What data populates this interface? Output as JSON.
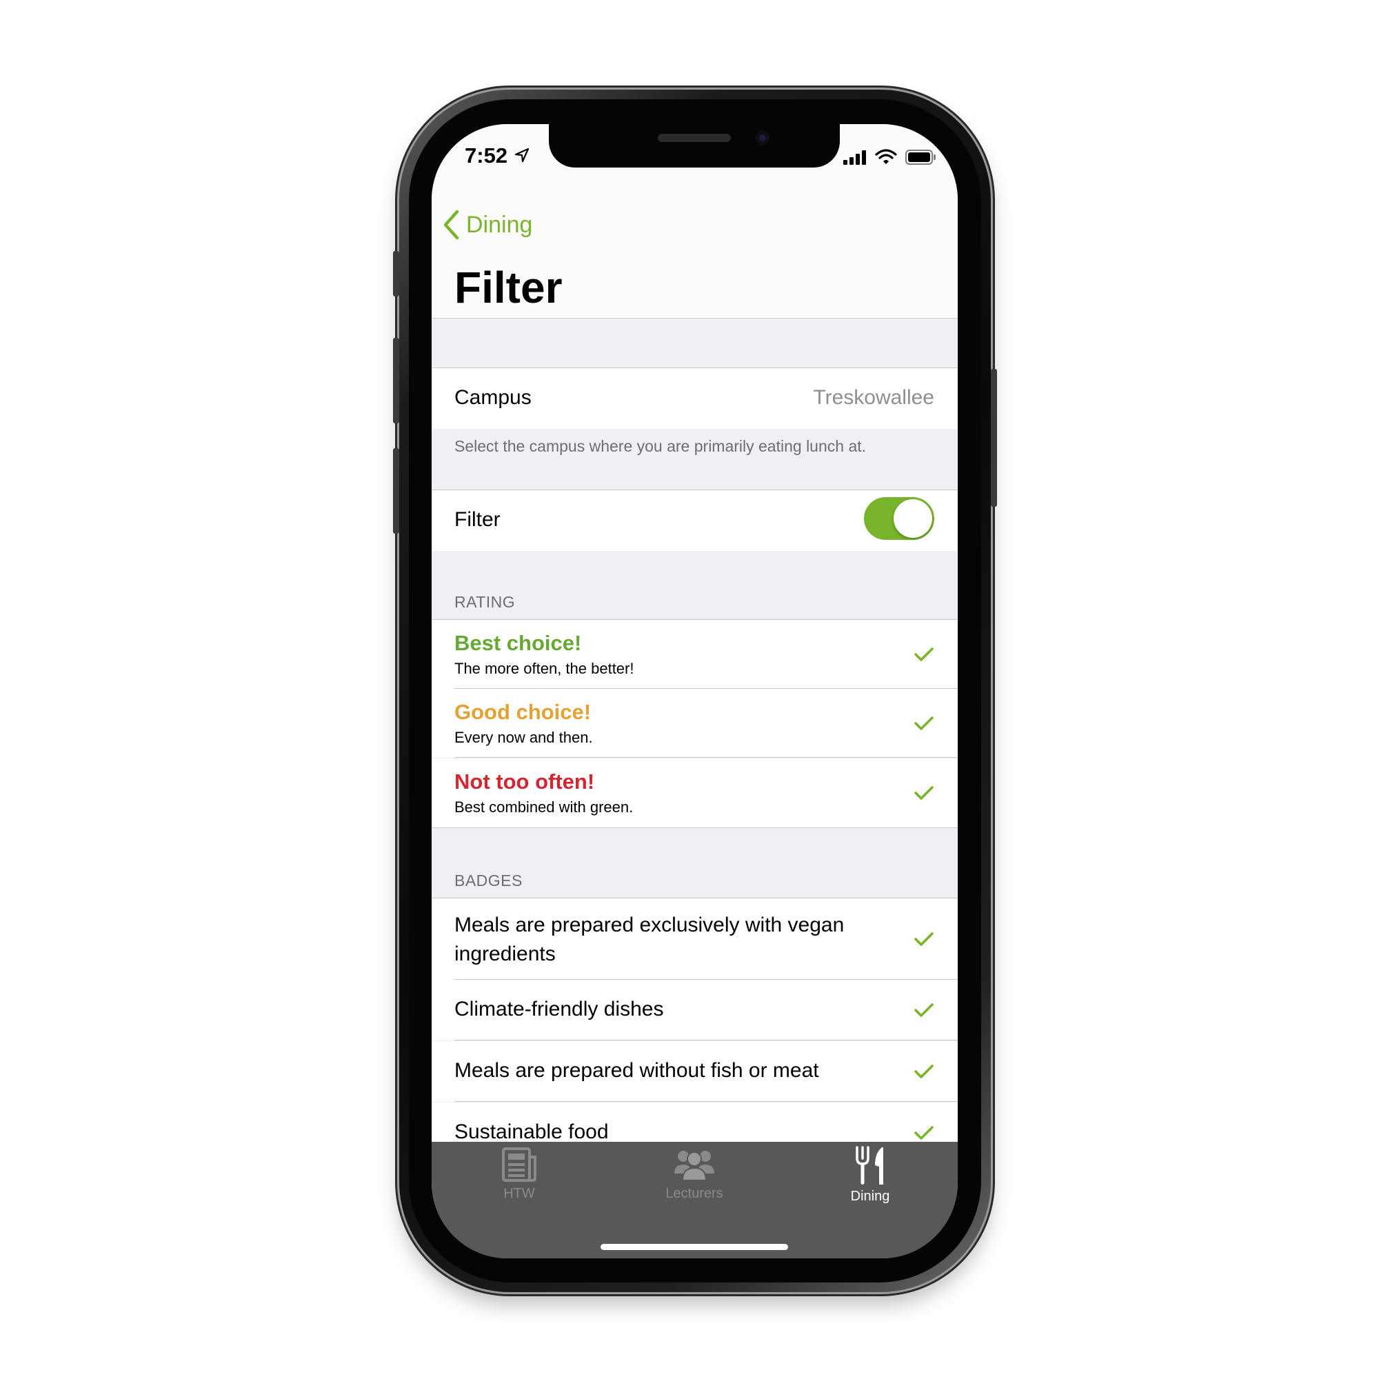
{
  "status_bar": {
    "time": "7:52"
  },
  "nav": {
    "back_label": "Dining",
    "title": "Filter"
  },
  "campus": {
    "label": "Campus",
    "value": "Treskowallee",
    "footer": "Select the campus where you are primarily eating lunch at."
  },
  "filter": {
    "label": "Filter",
    "enabled": true
  },
  "rating": {
    "header": "RATING",
    "items": [
      {
        "title": "Best choice!",
        "subtitle": "The more often, the better!",
        "color": "#65a832",
        "checked": true
      },
      {
        "title": "Good choice!",
        "subtitle": "Every now and then.",
        "color": "#e3a233",
        "checked": true
      },
      {
        "title": "Not too often!",
        "subtitle": "Best combined with green.",
        "color": "#d3272f",
        "checked": true
      }
    ]
  },
  "badges": {
    "header": "BADGES",
    "items": [
      {
        "label": "Meals are prepared exclusively with vegan ingredients",
        "checked": true
      },
      {
        "label": "Climate-friendly dishes",
        "checked": true
      },
      {
        "label": "Meals are prepared without fish or meat",
        "checked": true
      },
      {
        "label": "Sustainable food",
        "checked": true
      }
    ]
  },
  "tab_bar": {
    "tabs": [
      {
        "label": "HTW",
        "icon": "newspaper-icon",
        "selected": false
      },
      {
        "label": "Lecturers",
        "icon": "people-icon",
        "selected": false
      },
      {
        "label": "Dining",
        "icon": "fork-knife-icon",
        "selected": true
      }
    ]
  },
  "colors": {
    "accent": "#79b52b",
    "check": "#79b52b",
    "tab_inactive": "#8a8a8a",
    "tab_active": "#ffffff",
    "tab_bar_bg": "#585858"
  }
}
